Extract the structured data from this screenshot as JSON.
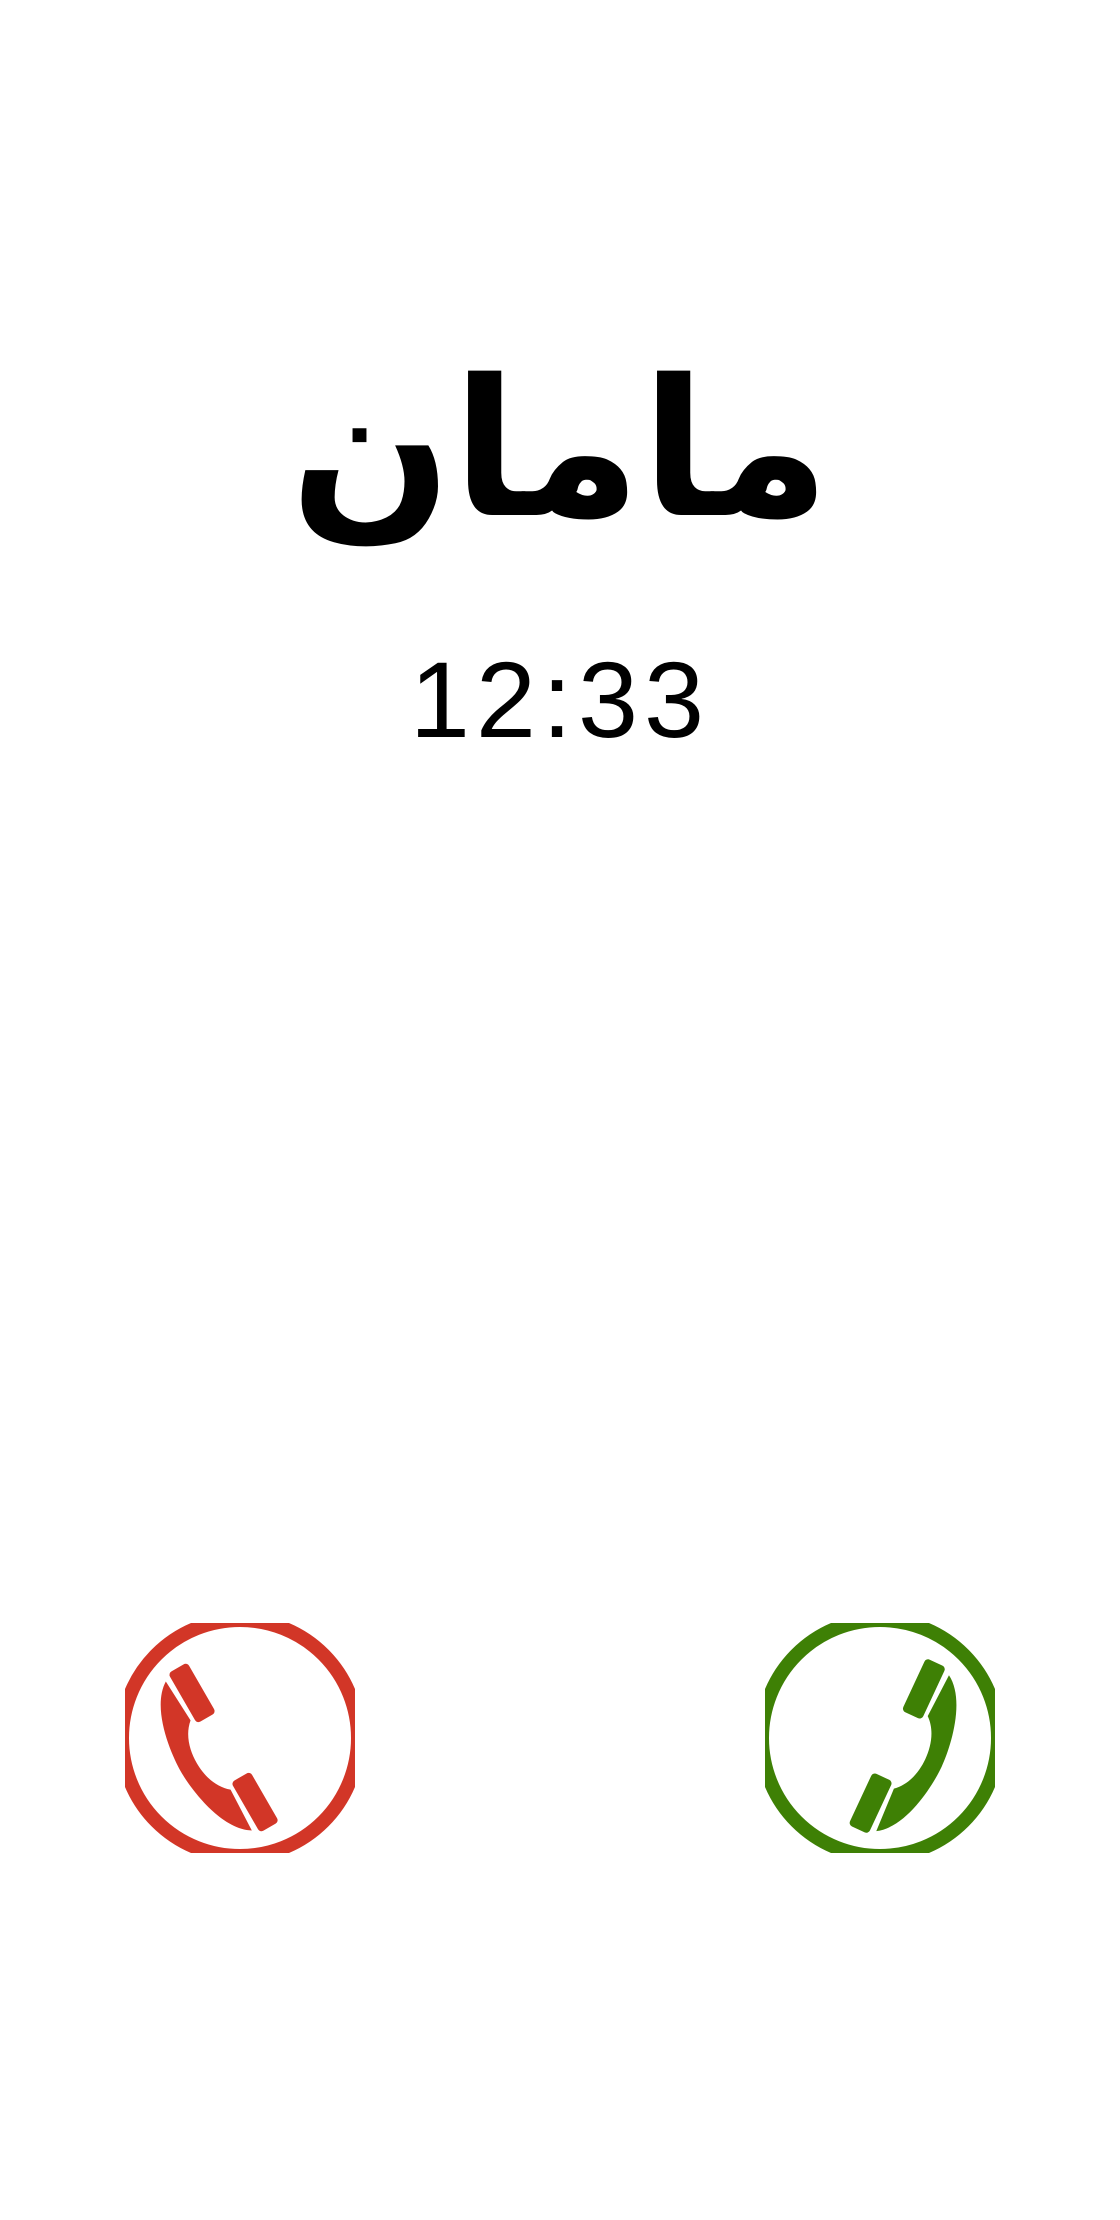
{
  "caller": {
    "name": "مامان"
  },
  "call": {
    "timer": "12:33"
  },
  "buttons": {
    "decline": {
      "icon": "phone-hangup-icon",
      "color": "#d23627"
    },
    "accept": {
      "icon": "phone-answer-icon",
      "color": "#3e8005"
    }
  },
  "colors": {
    "background": "#ffffff",
    "text": "#000000"
  }
}
